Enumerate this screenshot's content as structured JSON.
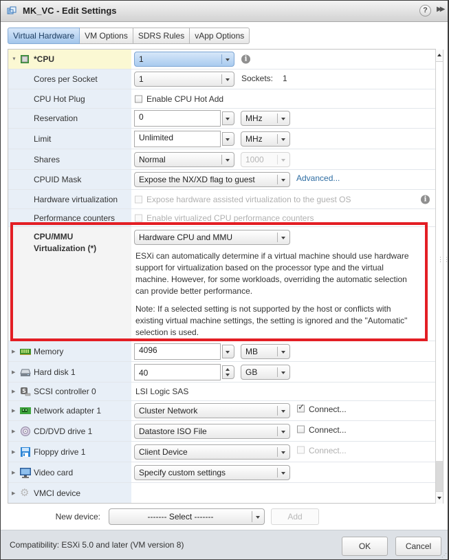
{
  "window": {
    "title": "MK_VC - Edit Settings",
    "help_label": "?",
    "collapse_label": "▶▶"
  },
  "tabs": [
    {
      "label": "Virtual Hardware",
      "active": true
    },
    {
      "label": "VM Options",
      "active": false
    },
    {
      "label": "SDRS Rules",
      "active": false
    },
    {
      "label": "vApp Options",
      "active": false
    }
  ],
  "cpu": {
    "label": "*CPU",
    "value": "1",
    "expanded": true,
    "info_glyph": "i",
    "cores_per_socket": {
      "label": "Cores per Socket",
      "value": "1",
      "sockets_label": "Sockets:",
      "sockets_value": "1"
    },
    "hot_plug": {
      "label": "CPU Hot Plug",
      "checkbox_label": "Enable CPU Hot Add",
      "checked": false
    },
    "reservation": {
      "label": "Reservation",
      "value": "0",
      "unit": "MHz"
    },
    "limit": {
      "label": "Limit",
      "value": "Unlimited",
      "unit": "MHz"
    },
    "shares": {
      "label": "Shares",
      "value": "Normal",
      "amount": "1000",
      "amount_disabled": true
    },
    "cpuid_mask": {
      "label": "CPUID Mask",
      "value": "Expose the NX/XD flag to guest",
      "link": "Advanced..."
    },
    "hw_virtualization": {
      "label": "Hardware virtualization",
      "checkbox_label": "Expose hardware assisted virtualization to the guest OS",
      "checked": false,
      "disabled": true
    },
    "perf_counters": {
      "label": "Performance counters",
      "checkbox_label": "Enable virtualized CPU performance counters",
      "checked": false,
      "disabled": true
    },
    "mmu_virtualization": {
      "label_line1": "CPU/MMU",
      "label_line2": "Virtualization (*)",
      "value": "Hardware CPU and MMU",
      "description": "ESXi can automatically determine if a virtual machine should use hardware support for virtualization based on the processor type and the virtual machine. However, for some workloads, overriding the automatic selection can provide better performance.",
      "note": "Note: If a selected setting is not supported by the host or conflicts with existing virtual machine settings, the setting is ignored and the \"Automatic\" selection is used."
    }
  },
  "devices": [
    {
      "label": "Memory",
      "icon": "memory-icon",
      "value": "4096",
      "unit": "MB"
    },
    {
      "label": "Hard disk 1",
      "icon": "hard-disk-icon",
      "value": "40",
      "unit": "GB"
    },
    {
      "label": "SCSI controller 0",
      "icon": "scsi-controller-icon",
      "value": "LSI Logic SAS"
    },
    {
      "label": "Network adapter 1",
      "icon": "network-adapter-icon",
      "value": "Cluster Network",
      "connect_label": "Connect...",
      "connect_checked": true,
      "connect_disabled": false
    },
    {
      "label": "CD/DVD drive 1",
      "icon": "cd-dvd-icon",
      "value": "Datastore ISO File",
      "connect_label": "Connect...",
      "connect_checked": false,
      "connect_disabled": false
    },
    {
      "label": "Floppy drive 1",
      "icon": "floppy-icon",
      "value": "Client Device",
      "connect_label": "Connect...",
      "connect_checked": false,
      "connect_disabled": true
    },
    {
      "label": "Video card",
      "icon": "video-card-icon",
      "value": "Specify custom settings"
    },
    {
      "label": "VMCI device",
      "icon": "vmci-device-icon"
    }
  ],
  "new_device": {
    "label": "New device:",
    "value": "------- Select -------",
    "add_label": "Add",
    "add_disabled": true
  },
  "footer": {
    "compatibility": "Compatibility: ESXi 5.0 and later (VM version 8)",
    "ok_label": "OK",
    "cancel_label": "Cancel"
  },
  "annotation": {
    "color": "#e31e24",
    "highlights": "CPU/MMU Virtualization"
  },
  "colors": {
    "active_tab": "#a3c6ec",
    "label_column": "#e8eff7",
    "selected_row": "#fbf8d3"
  }
}
